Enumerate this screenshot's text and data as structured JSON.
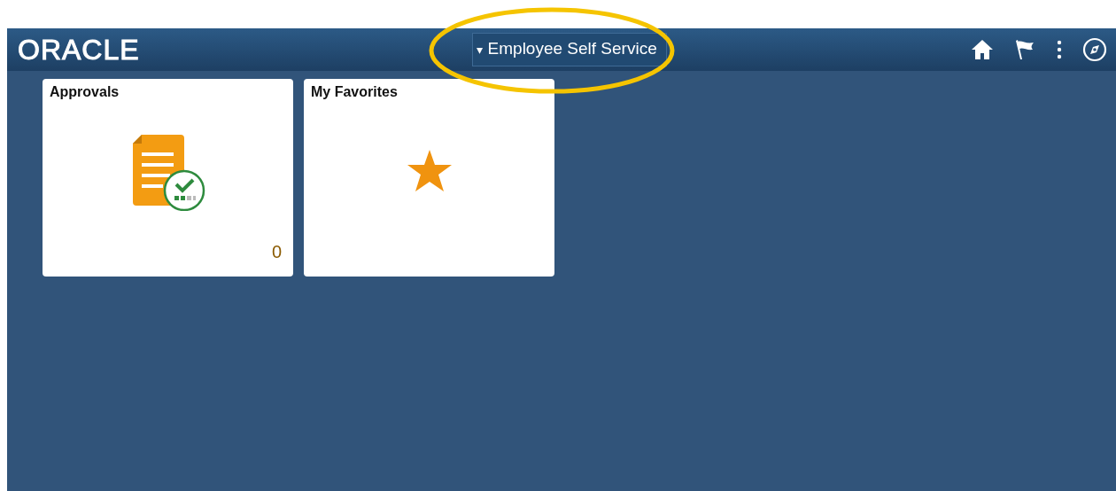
{
  "header": {
    "logo": "ORACLE",
    "title_menu": {
      "caret": "▾",
      "label": "Employee Self Service"
    }
  },
  "tiles": [
    {
      "kind": "approvals",
      "title": "Approvals",
      "count": "0"
    },
    {
      "kind": "favorites",
      "title": "My Favorites"
    }
  ],
  "annotation": {
    "kind": "ellipse",
    "color": "#f5c400"
  }
}
